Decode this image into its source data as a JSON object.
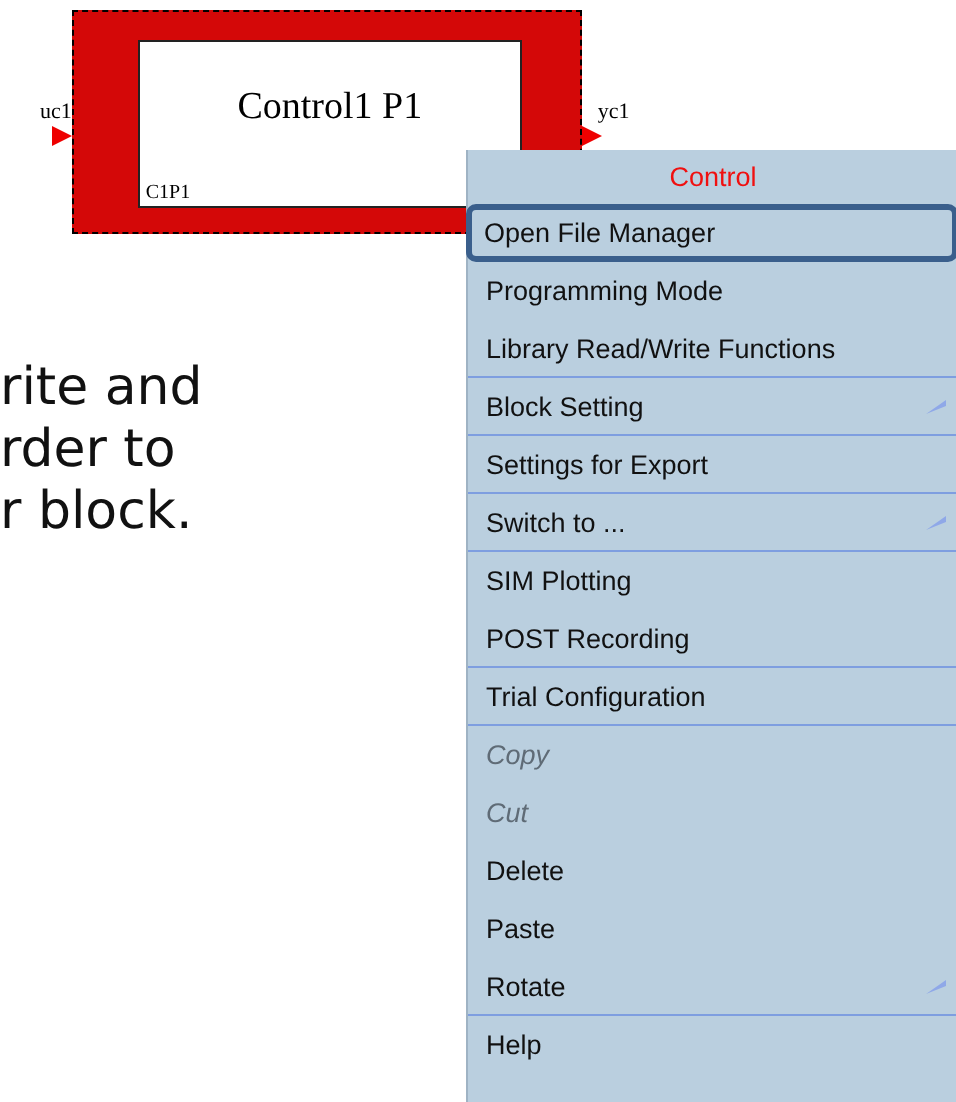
{
  "block": {
    "title": "Control1 P1",
    "id_label": "C1P1",
    "input_port": "uc1",
    "output_port": "yc1",
    "selected": true
  },
  "background_text": [
    "rite and",
    "rder to",
    "r block."
  ],
  "context_menu": {
    "title": "Control",
    "items": [
      {
        "label": "Open File Manager",
        "selected": true,
        "disabled": false,
        "submenu": false,
        "divider_below": false
      },
      {
        "label": "Programming Mode",
        "selected": false,
        "disabled": false,
        "submenu": false,
        "divider_below": false
      },
      {
        "label": "Library Read/Write Functions",
        "selected": false,
        "disabled": false,
        "submenu": false,
        "divider_below": true
      },
      {
        "label": "Block Setting",
        "selected": false,
        "disabled": false,
        "submenu": true,
        "divider_below": true
      },
      {
        "label": "Settings for Export",
        "selected": false,
        "disabled": false,
        "submenu": false,
        "divider_below": true
      },
      {
        "label": "Switch to ...",
        "selected": false,
        "disabled": false,
        "submenu": true,
        "divider_below": true
      },
      {
        "label": "SIM Plotting",
        "selected": false,
        "disabled": false,
        "submenu": false,
        "divider_below": false
      },
      {
        "label": "POST Recording",
        "selected": false,
        "disabled": false,
        "submenu": false,
        "divider_below": true
      },
      {
        "label": "Trial Configuration",
        "selected": false,
        "disabled": false,
        "submenu": false,
        "divider_below": true
      },
      {
        "label": "Copy",
        "selected": false,
        "disabled": true,
        "submenu": false,
        "divider_below": false
      },
      {
        "label": "Cut",
        "selected": false,
        "disabled": true,
        "submenu": false,
        "divider_below": false
      },
      {
        "label": "Delete",
        "selected": false,
        "disabled": false,
        "submenu": false,
        "divider_below": false
      },
      {
        "label": "Paste",
        "selected": false,
        "disabled": false,
        "submenu": false,
        "divider_below": false
      },
      {
        "label": "Rotate",
        "selected": false,
        "disabled": false,
        "submenu": true,
        "divider_below": true
      },
      {
        "label": "Help",
        "selected": false,
        "disabled": false,
        "submenu": false,
        "divider_below": false
      }
    ]
  }
}
